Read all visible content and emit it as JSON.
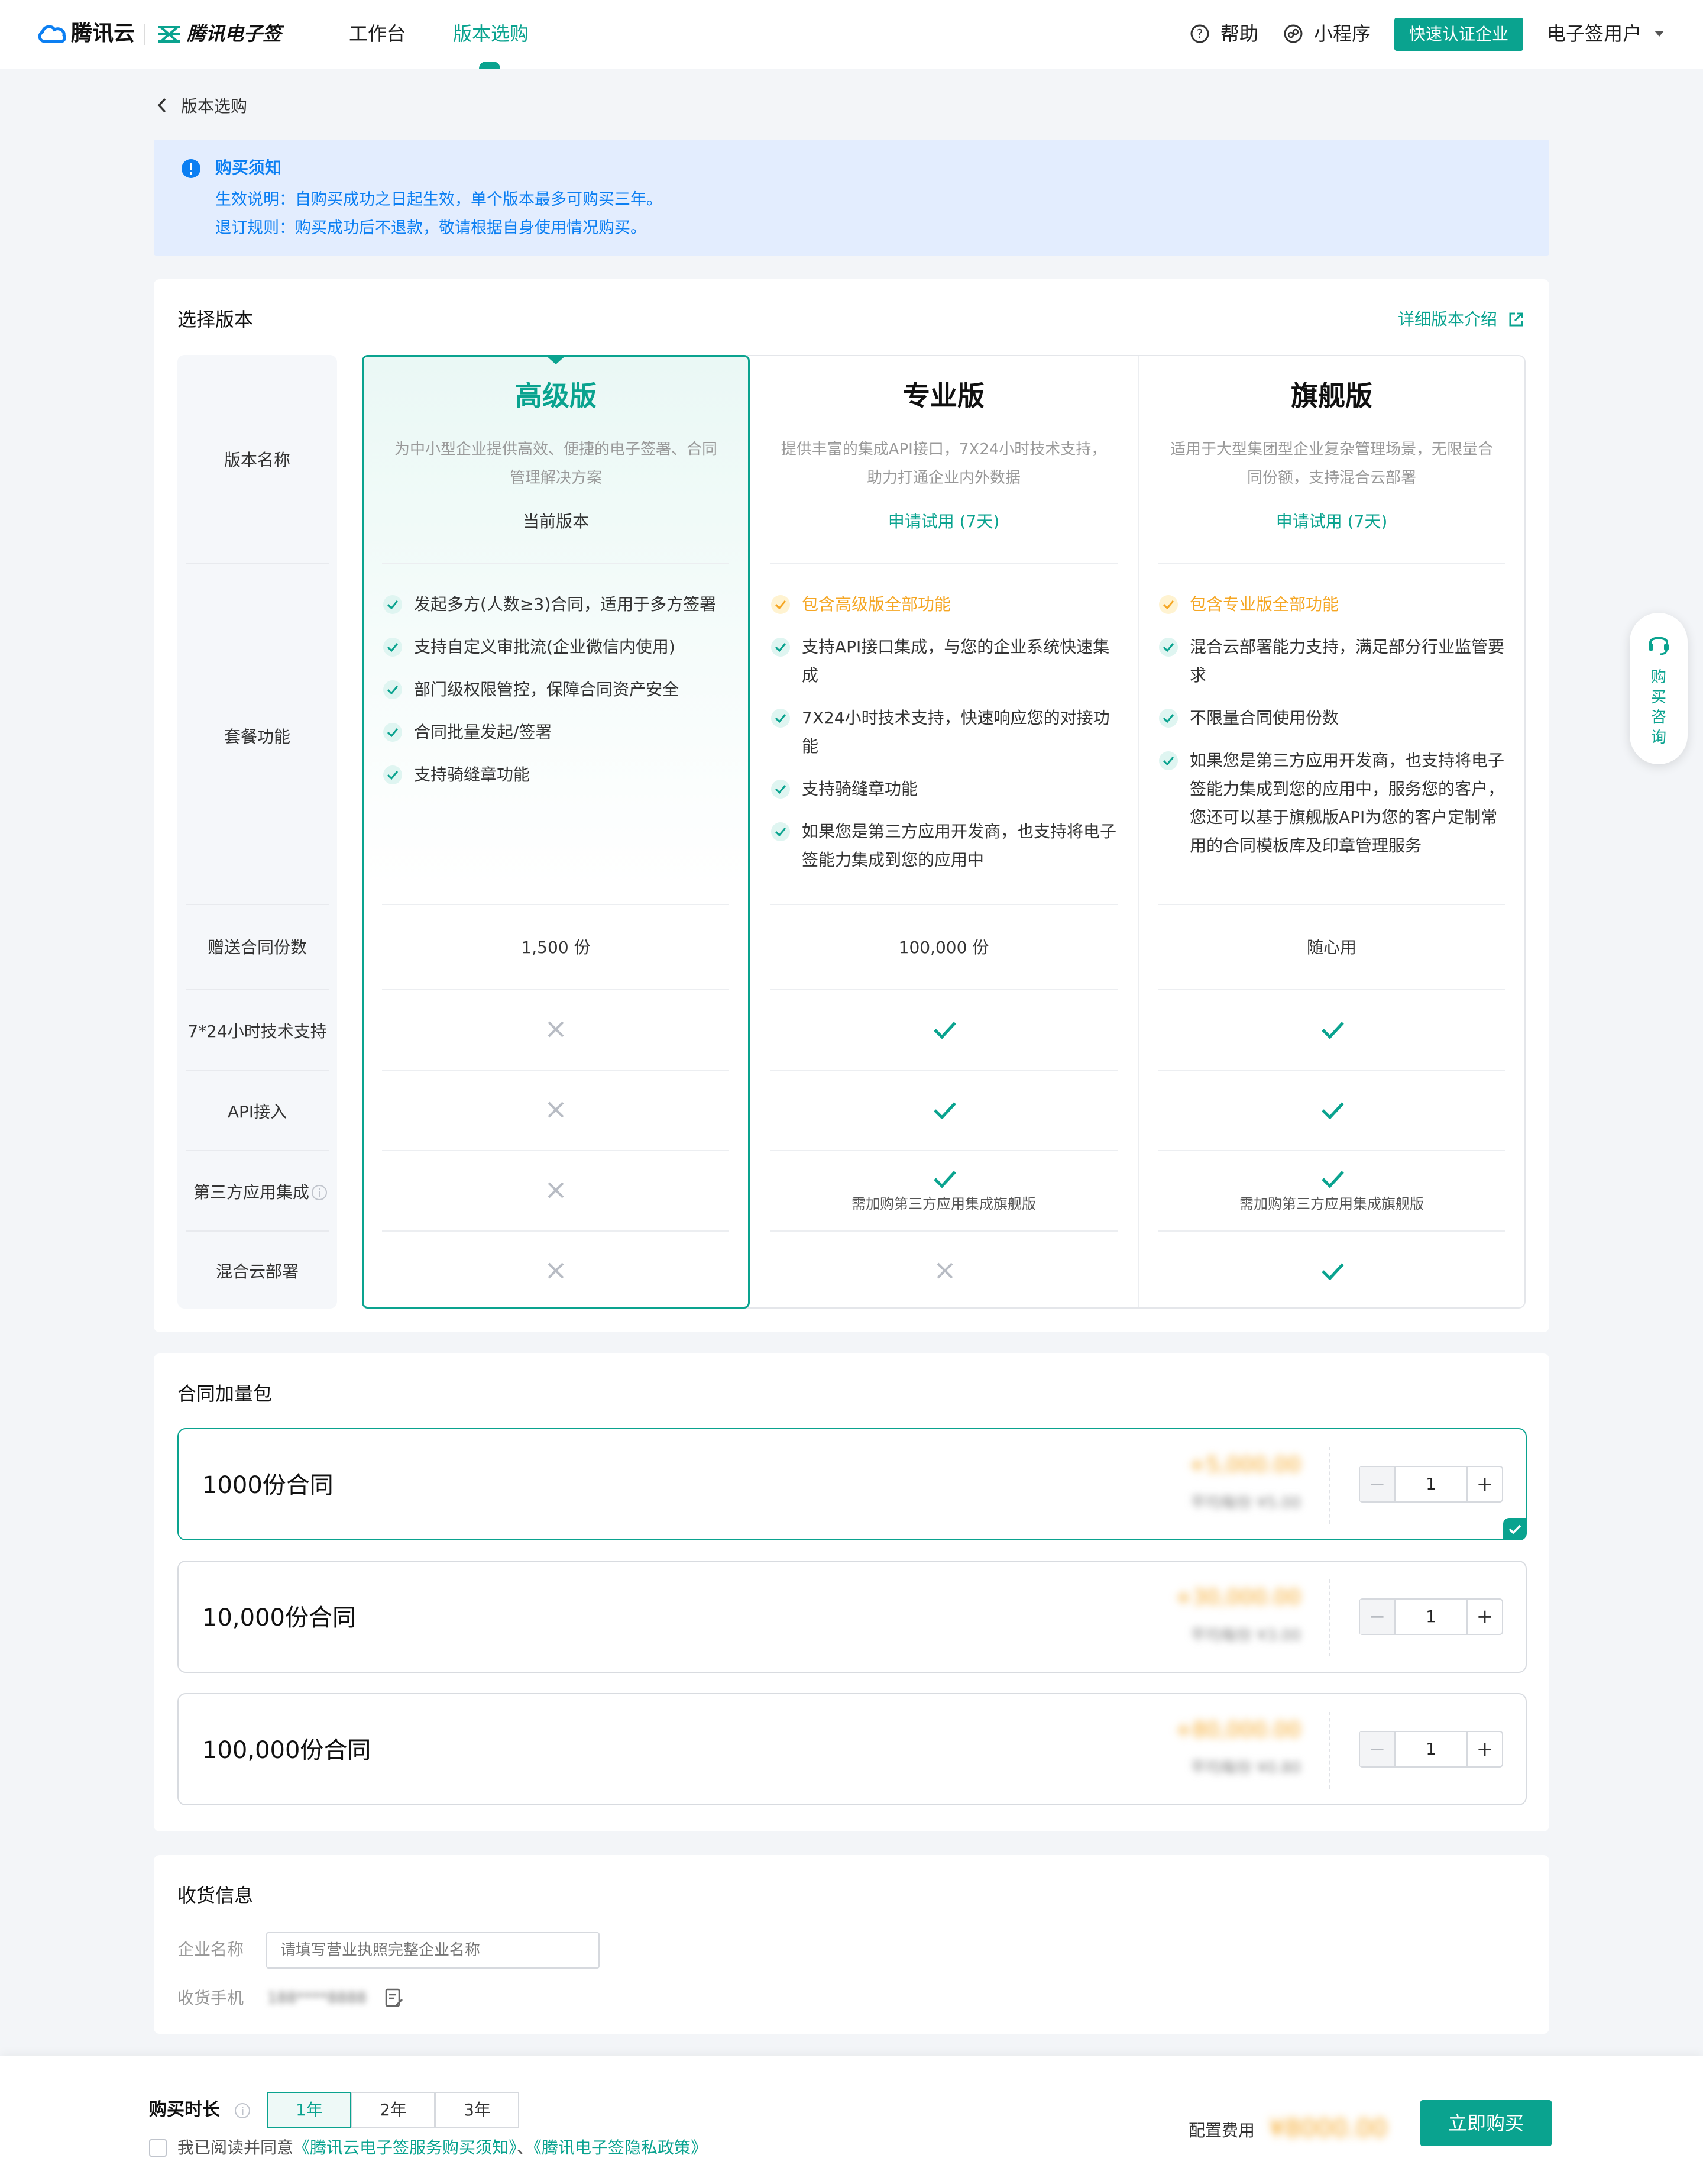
{
  "nav": {
    "brand": "腾讯云",
    "product": "腾讯电子签",
    "tabs": [
      {
        "label": "工作台"
      },
      {
        "label": "版本选购"
      }
    ],
    "help": "帮助",
    "miniapp": "小程序",
    "verify_button": "快速认证企业",
    "user": "电子签用户"
  },
  "breadcrumb": {
    "label": "版本选购"
  },
  "notice": {
    "title": "购买须知",
    "line1": "生效说明：自购买成功之日起生效，单个版本最多可购买三年。",
    "line2": "退订规则：购买成功后不退款，敬请根据自身使用情况购买。"
  },
  "versions_section": {
    "title": "选择版本",
    "detail_link": "详细版本介绍",
    "row_labels": {
      "name": "版本名称",
      "features": "套餐功能",
      "contracts": "赠送合同份数",
      "support": "7*24小时技术支持",
      "api": "API接入",
      "thirdparty": "第三方应用集成",
      "hybrid": "混合云部署"
    },
    "plans": [
      {
        "name": "高级版",
        "desc1": "为中小型企业提供高效、便捷的电子签署、合同",
        "desc2": "管理解决方案",
        "action": "当前版本",
        "features": [
          "发起多方(人数≥3)合同，适用于多方签署",
          "支持自定义审批流(企业微信内使用)",
          "部门级权限管控，保障合同资产安全",
          "合同批量发起/签署",
          "支持骑缝章功能"
        ],
        "contracts": "1,500 份"
      },
      {
        "name": "专业版",
        "desc1": "提供丰富的集成API接口，7X24小时技术支持，",
        "desc2": "助力打通企业内外数据",
        "action": "申请试用 (7天)",
        "highlight": "包含高级版全部功能",
        "f1a": "支持API接口集成，与您的企业系统快速集",
        "f1b": "成",
        "f2a": "7X24小时技术支持，快速响应您的对接功",
        "f2b": "能",
        "f3": "支持骑缝章功能",
        "f4a": "如果您是第三方应用开发商，也支持将电子",
        "f4b": "签能力集成到您的应用中",
        "contracts": "100,000 份",
        "thirdparty_note": "需加购第三方应用集成旗舰版"
      },
      {
        "name": "旗舰版",
        "desc1": "适用于大型集团型企业复杂管理场景，无限量合",
        "desc2": "同份额，支持混合云部署",
        "action": "申请试用 (7天)",
        "highlight": "包含专业版全部功能",
        "f1a": "混合云部署能力支持，满足部分行业监管要",
        "f1b": "求",
        "f2": "不限量合同使用份数",
        "f3a": "如果您是第三方应用开发商，也支持将电子",
        "f3b": "签能力集成到您的应用中，服务您的客户，",
        "f3c": "您还可以基于旗舰版API为您的客户定制常",
        "f3d": "用的合同模板库及印章管理服务",
        "contracts": "随心用",
        "thirdparty_note": "需加购第三方应用集成旗舰版"
      }
    ]
  },
  "addon_section": {
    "title": "合同加量包",
    "packages": [
      {
        "name": "1000份合同",
        "qty": "1"
      },
      {
        "name": "10,000份合同",
        "qty": "1"
      },
      {
        "name": "100,000份合同",
        "qty": "1"
      }
    ]
  },
  "delivery": {
    "title": "收货信息",
    "company_label": "企业名称",
    "company_placeholder": "请填写营业执照完整企业名称",
    "phone_label": "收货手机"
  },
  "footer": {
    "duration_label": "购买时长",
    "years": [
      "1年",
      "2年",
      "3年"
    ],
    "agree_prefix": "我已阅读并同意",
    "terms": "《腾讯云电子签服务购买须知》",
    "and": "、",
    "privacy": "《腾讯电子签隐私政策》",
    "fee_label": "配置费用",
    "buy_button": "立即购买"
  },
  "colors": {
    "primary": "#0aa38f",
    "link": "#0c7ff2",
    "notice_bg": "#e3edfe",
    "warn": "#f5a623"
  }
}
